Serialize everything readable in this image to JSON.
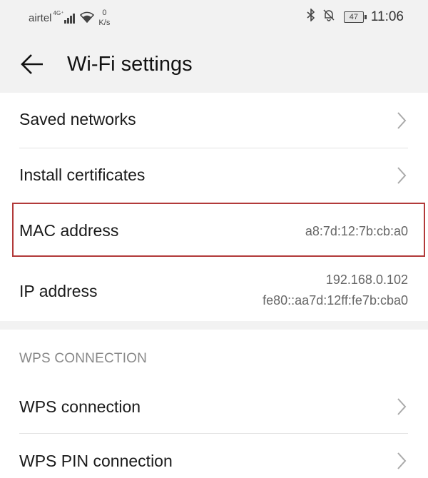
{
  "status_bar": {
    "carrier": "airtel",
    "network_type": "4G⁺",
    "data_speed_value": "0",
    "data_speed_unit": "K/s",
    "battery": "47",
    "time": "11:06"
  },
  "header": {
    "title": "Wi-Fi settings"
  },
  "rows": {
    "saved_networks": {
      "label": "Saved networks"
    },
    "install_certificates": {
      "label": "Install certificates"
    },
    "mac_address": {
      "label": "MAC address",
      "value": "a8:7d:12:7b:cb:a0"
    },
    "ip_address": {
      "label": "IP address",
      "ipv4": "192.168.0.102",
      "ipv6": "fe80::aa7d:12ff:fe7b:cba0"
    }
  },
  "section": {
    "title": "WPS CONNECTION"
  },
  "wps_rows": {
    "wps_connection": {
      "label": "WPS connection"
    },
    "wps_pin_connection": {
      "label": "WPS PIN connection"
    }
  },
  "colors": {
    "background": "#f2f2f2",
    "card": "#ffffff",
    "highlight": "#b23a3a",
    "secondary_text": "#666666"
  }
}
